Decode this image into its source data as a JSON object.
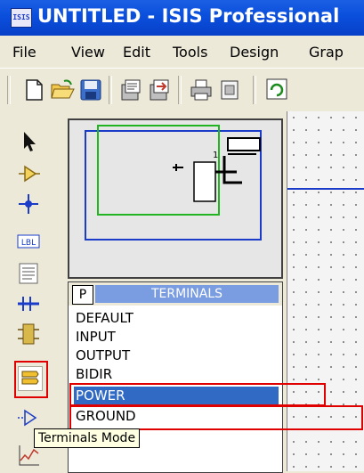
{
  "window": {
    "title": "UNTITLED - ISIS Professional",
    "app_icon": "ISIS",
    "title_color": "#0a4fdc"
  },
  "menu": {
    "items": [
      "File",
      "View",
      "Edit",
      "Tools",
      "Design",
      "Grap"
    ]
  },
  "toolbar": {
    "icons": [
      "new-icon",
      "open-icon",
      "save-icon",
      "import-icon",
      "export-icon",
      "print-icon",
      "area-icon",
      "refresh-icon"
    ]
  },
  "left_tools": {
    "icons": [
      "selection-icon",
      "component-icon",
      "junction-dot-icon",
      "wire-label-icon",
      "text-script-icon",
      "buses-icon",
      "subcircuit-icon",
      "terminals-mode-icon",
      "device-pins-icon",
      "graph-icon"
    ],
    "label_tool_text": "LBL",
    "selected": "terminals-mode-icon"
  },
  "overview": {
    "component_label": "1"
  },
  "terminals_panel": {
    "picker_label": "P",
    "title": "TERMINALS",
    "items": [
      "DEFAULT",
      "INPUT",
      "OUTPUT",
      "BIDIR",
      "POWER",
      "GROUND"
    ],
    "selected_index": 4
  },
  "tooltip": {
    "text": "Terminals Mode"
  },
  "colors": {
    "highlight": "#e00000",
    "selection": "#316ac5",
    "panel_header": "#7a9ce0"
  }
}
